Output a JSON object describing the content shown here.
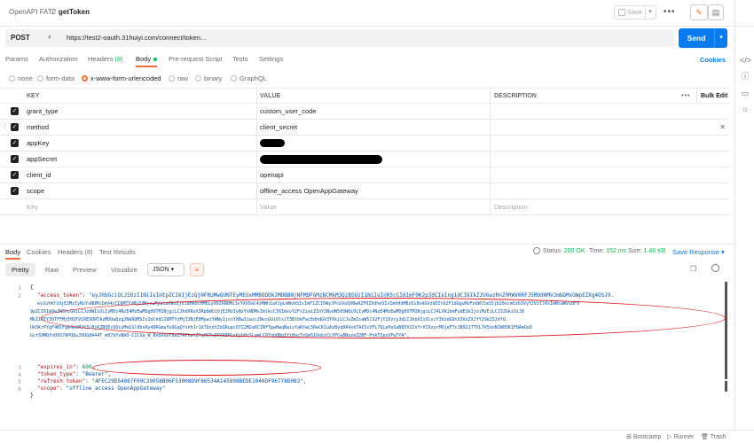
{
  "header": {
    "collection": "OpenAPI FAT2",
    "separator": "/",
    "request_name": "getToken",
    "save_label": "Save"
  },
  "request": {
    "method": "POST",
    "url": "https://test2-oauth.31huiyi.com/connect/token...",
    "send_label": "Send"
  },
  "tabs": [
    {
      "label": "Params"
    },
    {
      "label": "Authorization"
    },
    {
      "label": "Headers",
      "count": "(8)"
    },
    {
      "label": "Body"
    },
    {
      "label": "Pre-request Script"
    },
    {
      "label": "Tests"
    },
    {
      "label": "Settings"
    }
  ],
  "cookies_label": "Cookies",
  "body_types": [
    "none",
    "form-data",
    "x-www-form-urlencoded",
    "raw",
    "binary",
    "GraphQL"
  ],
  "kv_headers": {
    "key": "KEY",
    "value": "VALUE",
    "description": "DESCRIPTION",
    "bulk": "Bulk Edit"
  },
  "kv_rows": [
    {
      "key": "grant_type",
      "value": "custom_user_code"
    },
    {
      "key": "method",
      "value": "client_secret"
    },
    {
      "key": "appKey",
      "value": ""
    },
    {
      "key": "appSecret",
      "value": ""
    },
    {
      "key": "client_id",
      "value": "openapi"
    },
    {
      "key": "scope",
      "value": "offline_access OpenAppGateway"
    }
  ],
  "kv_placeholder": {
    "key": "Key",
    "value": "Value",
    "description": "Description"
  },
  "response_tabs": [
    {
      "label": "Body"
    },
    {
      "label": "Cookies"
    },
    {
      "label": "Headers (8)"
    },
    {
      "label": "Test Results"
    }
  ],
  "response_meta": {
    "status_label": "Status:",
    "status": "200 OK",
    "time_label": "Time:",
    "time": "152 ms",
    "size_label": "Size:",
    "size": "1.48 KB",
    "save_response": "Save Response"
  },
  "format_buttons": [
    "Pretty",
    "Raw",
    "Preview",
    "Visualize"
  ],
  "format_type": "JSON",
  "json_lines": {
    "l1": "{",
    "l2_key": "\"access_token\"",
    "l2_val": "\"eyJhbGciOiJSUzI1NiIsImtpZCI6IjEzQjNFRUMwQUNTEyMEUxMMBODDk2MDBBNjNFMDFGMzBCMkM3QzBSUzI1NiIsInR5cCI6ImF0K2p3dCIsIng1dCI6IkZ2UGwzRnZ0RWV0RFJ5MUd0MVJmbDMxOWpEZXg4OSJ9.",
    "wrap": [
      "eyJuYmYiOjE2MzIyNzYxNDMsImV4cCI6MTYzMjI3NjcwMywiaXNzIjoiaHR0cHM6Ly90ZXN0Mi1vYXV0aC4zMWh1aXlpLmNvbSIsImF1ZCI6WyJPcGVuQXBwR2F0ZXdheSIsImh0dHBzOi8vdGVzdDItb2F1dGguMzFodWl5aS5jb20vcmVzb3VyY2VzIl0sImNsaWVudF9",
      "9pZCI6Im9wZW5hcGkiLCJzdWIiOiIyMDc4NzE4MzEwMDg0OTM1NjgiLCJhdXRoX3RpbWUiOjE2MzIyNzYxNDMsImlkcCI6ImxvY2FsIiwiZ1hY2NvdW50SWQiOiIyMDc4NzE4MzEwMDg0OTM1NjgiLCJ4LXR1bmFudE1kIjoiMzEiLCJ3ZGkiOiJ8",
      "MkI1OTY3QTFFMjE0QTVCREVDRTAzMUUwQzg2NkRDMSIsImlhdCI6MTYzMjI3NjE0MywiYWNyIjoiYXBwIiwic2NvcGUiOlsiT3BlbkFwcEdhdGV3YXkiLCJvZmZsaW5lX2FjY2VzcyJdLCJhbXIiOlsiY3VzdG9tX3VzZXJfY29kZSJdfQ.",
      "Uk5KrPYgF4HlFgm4wkM2t5LBjKZBQEcOOisMnGSl0bsRy40RGmuYu9GqQfshhJr1kTQxdtZd1RupcO7Z2M2a6CINfTpwHwqNaivfaRfwL5RwCK1uAzByq0AVokTAI5sVFL7QLePeSaB85V2InYrVI9zyrMOjeFTc1B92J7TVL7V5ovNJW85K1F8AmOoD"
    ],
    "expires_key": "\"expires_in\"",
    "expires_val": "600",
    "type_key": "\"token_type\"",
    "type_val": "\"Bearer\"",
    "refresh_key": "\"refresh_token\"",
    "refresh_val": "\"4FEC29D54087F09C3995BB06F53008D9F86534A145898BEDE1040DF96778D0B3\"",
    "scope_key": "\"scope\"",
    "scope_val": "\"offline_access OpenAppGateway\"",
    "close": "}",
    "extra": "GctS9MQfnOOS7APQQuJOUG0A44T_m07bYvNbO-C1lSa_W_BnQV6DF8aZ7AFkwtZYqHV7xDPARBPLnQjbHrSLwmLC07nbQBg1YiHncTxSm51OobiCLYPCw8NuzeZ2BF-PnkTIpuVFwTYA\","
  },
  "status_bar": [
    "Bootcamp",
    "Runner",
    "Trash"
  ]
}
